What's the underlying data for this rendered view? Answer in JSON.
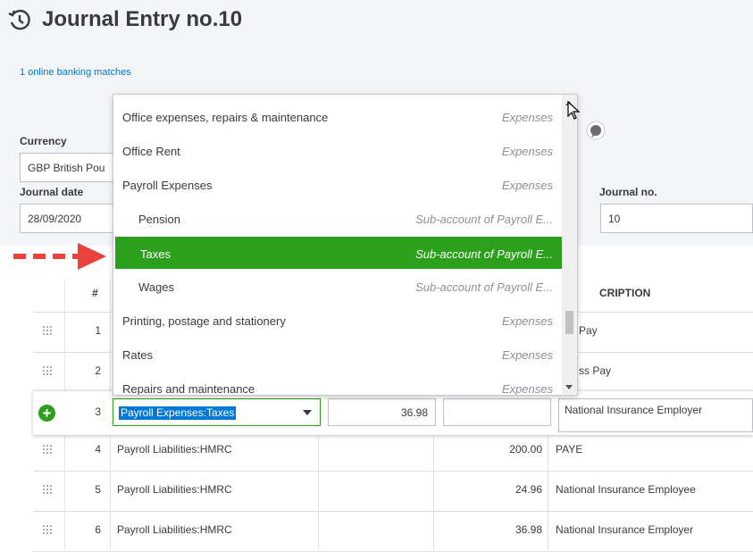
{
  "header": {
    "title": "Journal Entry no.10",
    "banking_matches": "1 online banking matches"
  },
  "form": {
    "currency_label": "Currency",
    "currency_value": "GBP British Pou",
    "journal_date_label": "Journal date",
    "journal_date_value": "28/09/2020",
    "journal_no_label": "Journal no.",
    "journal_no_value": "10"
  },
  "table": {
    "col_num": "#",
    "col_desc": "CRIPTION",
    "rows": [
      {
        "num": "1",
        "account": "",
        "debit": "",
        "desc": "Pay"
      },
      {
        "num": "2",
        "account": "",
        "debit": "",
        "desc": "ss Pay"
      },
      {
        "num": "3",
        "account": "Payroll Expenses:Taxes",
        "debit": "36.98",
        "desc": "National Insurance Employer"
      },
      {
        "num": "4",
        "account": "Payroll Liabilities:HMRC",
        "debit": "200.00",
        "desc": "PAYE"
      },
      {
        "num": "5",
        "account": "Payroll Liabilities:HMRC",
        "debit": "24.96",
        "desc": "National Insurance Employee"
      },
      {
        "num": "6",
        "account": "Payroll Liabilities:HMRC",
        "debit": "36.98",
        "desc": "National Insurance Employer"
      }
    ]
  },
  "dropdown": {
    "options": [
      {
        "name": "Office expenses, repairs & maintenance",
        "type": "Expenses"
      },
      {
        "name": "Office Rent",
        "type": "Expenses"
      },
      {
        "name": "Payroll Expenses",
        "type": "Expenses"
      },
      {
        "name": "Pension",
        "type": "Sub-account of Payroll E..."
      },
      {
        "name": "Taxes",
        "type": "Sub-account of Payroll E..."
      },
      {
        "name": "Wages",
        "type": "Sub-account of Payroll E..."
      },
      {
        "name": "Printing, postage and stationery",
        "type": "Expenses"
      },
      {
        "name": "Rates",
        "type": "Expenses"
      },
      {
        "name": "Repairs and maintenance",
        "type": "Expenses"
      }
    ]
  },
  "colors": {
    "accent_green": "#2ca01c",
    "link_blue": "#0077c5",
    "arrow_red": "#e8423b",
    "selection_blue": "#0078d7"
  }
}
